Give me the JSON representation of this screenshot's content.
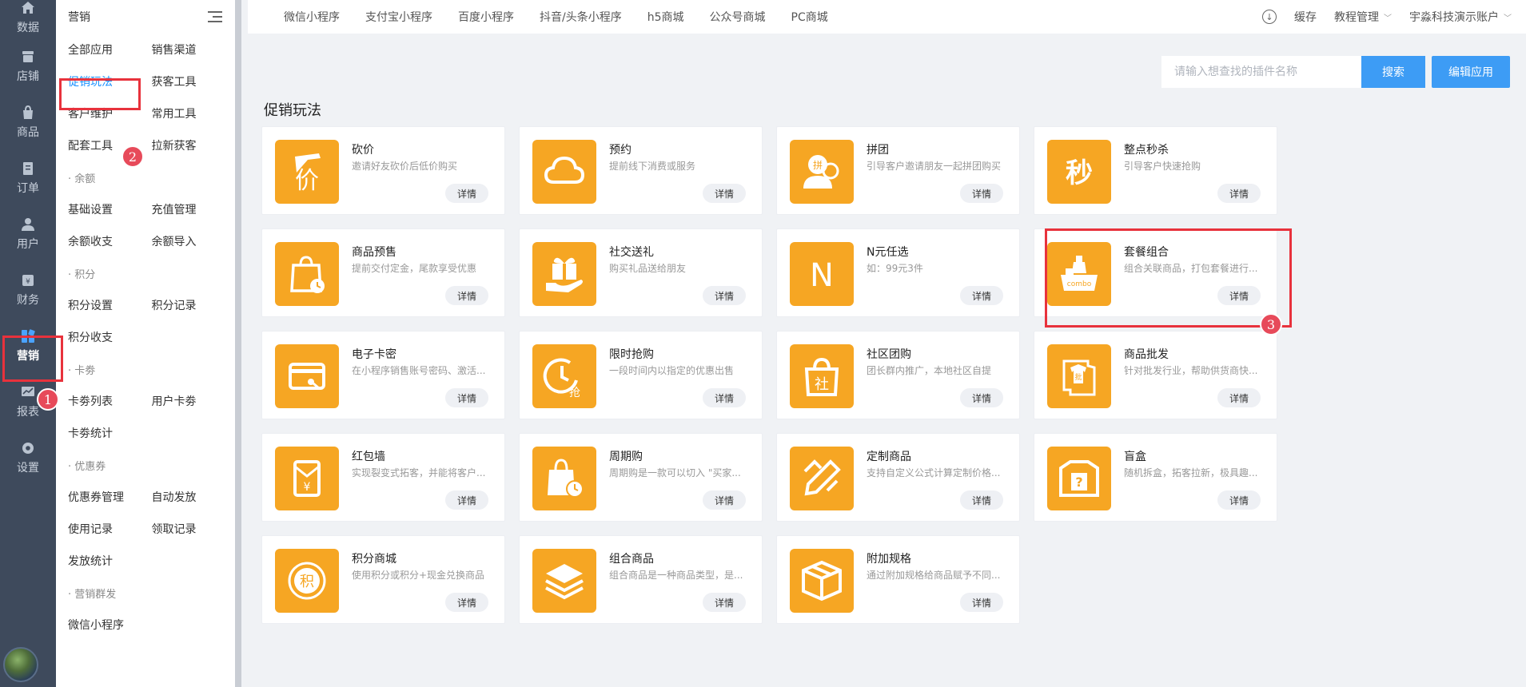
{
  "rail": [
    {
      "label": "数据",
      "icon": "home-icon"
    },
    {
      "label": "店铺",
      "icon": "store-icon"
    },
    {
      "label": "商品",
      "icon": "bag-icon"
    },
    {
      "label": "订单",
      "icon": "order-icon"
    },
    {
      "label": "用户",
      "icon": "user-icon"
    },
    {
      "label": "财务",
      "icon": "finance-icon"
    },
    {
      "label": "营销",
      "icon": "marketing-icon",
      "active": true
    },
    {
      "label": "报表",
      "icon": "report-icon"
    },
    {
      "label": "设置",
      "icon": "settings-icon"
    }
  ],
  "subnav": {
    "title": "营销",
    "rows": [
      [
        "全部应用",
        "销售渠道"
      ],
      [
        "促销玩法",
        "获客工具"
      ],
      [
        "客户维护",
        "常用工具"
      ],
      [
        "配套工具",
        "拉新获客"
      ]
    ],
    "groups": [
      {
        "label": "· 余额",
        "rows": [
          [
            "基础设置",
            "充值管理"
          ],
          [
            "余额收支",
            "余额导入"
          ]
        ]
      },
      {
        "label": "· 积分",
        "rows": [
          [
            "积分设置",
            "积分记录"
          ],
          [
            "积分收支",
            ""
          ]
        ]
      },
      {
        "label": "· 卡劵",
        "rows": [
          [
            "卡劵列表",
            "用户卡劵"
          ],
          [
            "卡劵统计",
            ""
          ]
        ]
      },
      {
        "label": "· 优惠券",
        "rows": [
          [
            "优惠券管理",
            "自动发放"
          ],
          [
            "使用记录",
            "领取记录"
          ],
          [
            "发放统计",
            ""
          ]
        ]
      },
      {
        "label": "· 营销群发",
        "rows": [
          [
            "微信小程序",
            ""
          ]
        ]
      }
    ]
  },
  "topbar": {
    "tabs": [
      "微信小程序",
      "支付宝小程序",
      "百度小程序",
      "抖音/头条小程序",
      "h5商城",
      "公众号商城",
      "PC商城"
    ],
    "cache": "缓存",
    "tutorial": "教程管理",
    "account": "宇淼科技演示账户"
  },
  "search": {
    "placeholder": "请输入想查找的插件名称",
    "button": "搜索"
  },
  "edit_button": "编辑应用",
  "section_title": "促销玩法",
  "detail_label": "详情",
  "accent_color": "#f6a623",
  "primary_color": "#3d9cf5",
  "cards": [
    {
      "title": "砍价",
      "desc": "邀请好友砍价后低价购买",
      "icon": "bargain-icon"
    },
    {
      "title": "预约",
      "desc": "提前线下消费或服务",
      "icon": "cloud-icon"
    },
    {
      "title": "拼团",
      "desc": "引导客户邀请朋友一起拼团购买",
      "icon": "group-buy-icon"
    },
    {
      "title": "整点秒杀",
      "desc": "引导客户快速抢购",
      "icon": "flash-sale-icon"
    },
    {
      "title": "商品预售",
      "desc": "提前交付定金，尾款享受优惠",
      "icon": "presale-icon"
    },
    {
      "title": "社交送礼",
      "desc": "购买礼品送给朋友",
      "icon": "gift-icon"
    },
    {
      "title": "N元任选",
      "desc": "如：99元3件",
      "icon": "n-choice-icon"
    },
    {
      "title": "套餐组合",
      "desc": "组合关联商品，打包套餐进行...",
      "icon": "combo-icon"
    },
    {
      "title": "电子卡密",
      "desc": "在小程序销售账号密码、激活...",
      "icon": "card-key-icon"
    },
    {
      "title": "限时抢购",
      "desc": "一段时间内以指定的优惠出售",
      "icon": "limited-time-icon"
    },
    {
      "title": "社区团购",
      "desc": "团长群内推广，本地社区自提",
      "icon": "community-icon"
    },
    {
      "title": "商品批发",
      "desc": "针对批发行业，帮助供货商快...",
      "icon": "wholesale-icon"
    },
    {
      "title": "红包墙",
      "desc": "实现裂变式拓客，并能将客户...",
      "icon": "red-packet-icon"
    },
    {
      "title": "周期购",
      "desc": "周期购是一款可以切入 \"买家...",
      "icon": "cycle-buy-icon"
    },
    {
      "title": "定制商品",
      "desc": "支持自定义公式计算定制价格...",
      "icon": "custom-icon"
    },
    {
      "title": "盲盒",
      "desc": "随机拆盒，拓客拉新，极具趣...",
      "icon": "blind-box-icon"
    },
    {
      "title": "积分商城",
      "desc": "使用积分或积分+现金兑换商品",
      "icon": "points-mall-icon"
    },
    {
      "title": "组合商品",
      "desc": "组合商品是一种商品类型，是...",
      "icon": "layers-icon"
    },
    {
      "title": "附加规格",
      "desc": "通过附加规格给商品赋予不同...",
      "icon": "box-icon"
    }
  ],
  "annotations": [
    "1",
    "2",
    "3"
  ]
}
